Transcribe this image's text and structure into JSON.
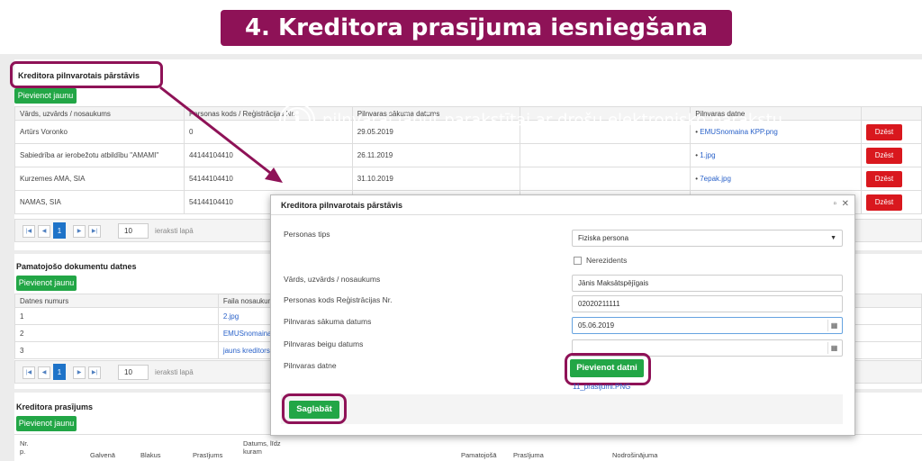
{
  "banner": {
    "title": "4. Kreditora prasījuma iesniegšana"
  },
  "annotations": {
    "info1": "datu ievade par kreditora pilnvaroto pārstāvi",
    "info2": "pilnvarai jābūt parakstītai ar drošu elektronisko parakstu"
  },
  "representative": {
    "title": "Kreditora pilnvarotais pārstāvis",
    "add_label": "Pievienot jaunu",
    "columns": [
      "Vārds, uzvārds / nosaukums",
      "Personas kods / Reģistrācijas Nr.",
      "Pilnvaras sākuma datums",
      "",
      "Pilnvaras datne",
      ""
    ],
    "rows": [
      {
        "name": "Artūrs Voronko",
        "code": "0",
        "date": "29.05.2019",
        "file": "EMUSnomaina KPP.png",
        "delete": "Dzēst"
      },
      {
        "name": "Sabiedrība ar ierobežotu atbildību \"AMAMI\"",
        "code": "44144104410",
        "date": "26.11.2019",
        "file": "1.jpg",
        "delete": "Dzēst"
      },
      {
        "name": "Kurzemes AMA, SIA",
        "code": "54144104410",
        "date": "31.10.2019",
        "file": "7epak.jpg",
        "delete": "Dzēst"
      },
      {
        "name": "NAMAS, SIA",
        "code": "54144104410",
        "date": "",
        "file": "",
        "delete": "Dzēst"
      }
    ],
    "pager": {
      "current": "1",
      "page_size": "10",
      "per_page_label": "ieraksti lapā"
    }
  },
  "documents": {
    "title": "Pamatojošo dokumentu datnes",
    "add_label": "Pievienot jaunu",
    "columns": [
      "Datnes numurs",
      "Faila nosaukums"
    ],
    "rows": [
      {
        "num": "1",
        "file": "2.jpg"
      },
      {
        "num": "2",
        "file": "EMUSnomaina"
      },
      {
        "num": "3",
        "file": "jauns kreditors"
      }
    ],
    "pager": {
      "current": "1",
      "page_size": "10",
      "per_page_label": "ieraksti lapā"
    }
  },
  "claims": {
    "title": "Kreditora prasījums",
    "add_label": "Pievienot jaunu",
    "columns": [
      "Nr. p.",
      "Galvenā",
      "Blakus",
      "Prasījums",
      "Datums, līdz kuram",
      "Pamatojošā",
      "Prasījuma",
      "Nodrošinājuma"
    ]
  },
  "modal": {
    "title": "Kreditora pilnvarotais pārstāvis",
    "person_type_label": "Personas tips",
    "person_type_value": "Fiziska persona",
    "nonresident_label": "Nerezidents",
    "name_label": "Vārds, uzvārds / nosaukums",
    "name_value": "Jānis Maksātspējīgais",
    "code_label": "Personas kods Reģistrācijas Nr.",
    "code_value": "02020211111",
    "start_label": "Pilnvaras sākuma datums",
    "start_value": "05.06.2019",
    "end_label": "Pilnvaras beigu datums",
    "end_value": "",
    "file_label": "Pilnvaras datne",
    "add_file_label": "Pievienot datni",
    "file_name": "11_prasijumi.PNG",
    "save_label": "Saglabāt"
  },
  "colors": {
    "accent": "#8e1257",
    "green": "#22a646",
    "red": "#d9181e"
  }
}
